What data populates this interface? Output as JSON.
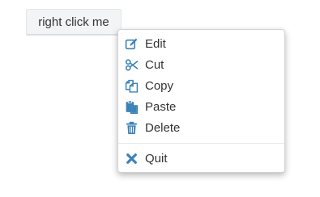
{
  "trigger": {
    "label": "right click me"
  },
  "context_menu": {
    "items": [
      {
        "id": "edit",
        "label": "Edit",
        "icon": "edit-icon"
      },
      {
        "id": "cut",
        "label": "Cut",
        "icon": "scissors-icon"
      },
      {
        "id": "copy",
        "label": "Copy",
        "icon": "copy-icon"
      },
      {
        "id": "paste",
        "label": "Paste",
        "icon": "paste-icon"
      },
      {
        "id": "delete",
        "label": "Delete",
        "icon": "trash-icon"
      }
    ],
    "footer_items": [
      {
        "id": "quit",
        "label": "Quit",
        "icon": "close-icon"
      }
    ]
  },
  "colors": {
    "icon": "#3b82b8",
    "text": "#333333",
    "button_bg": "#f2f4f5",
    "menu_border": "#cfd3d6"
  }
}
